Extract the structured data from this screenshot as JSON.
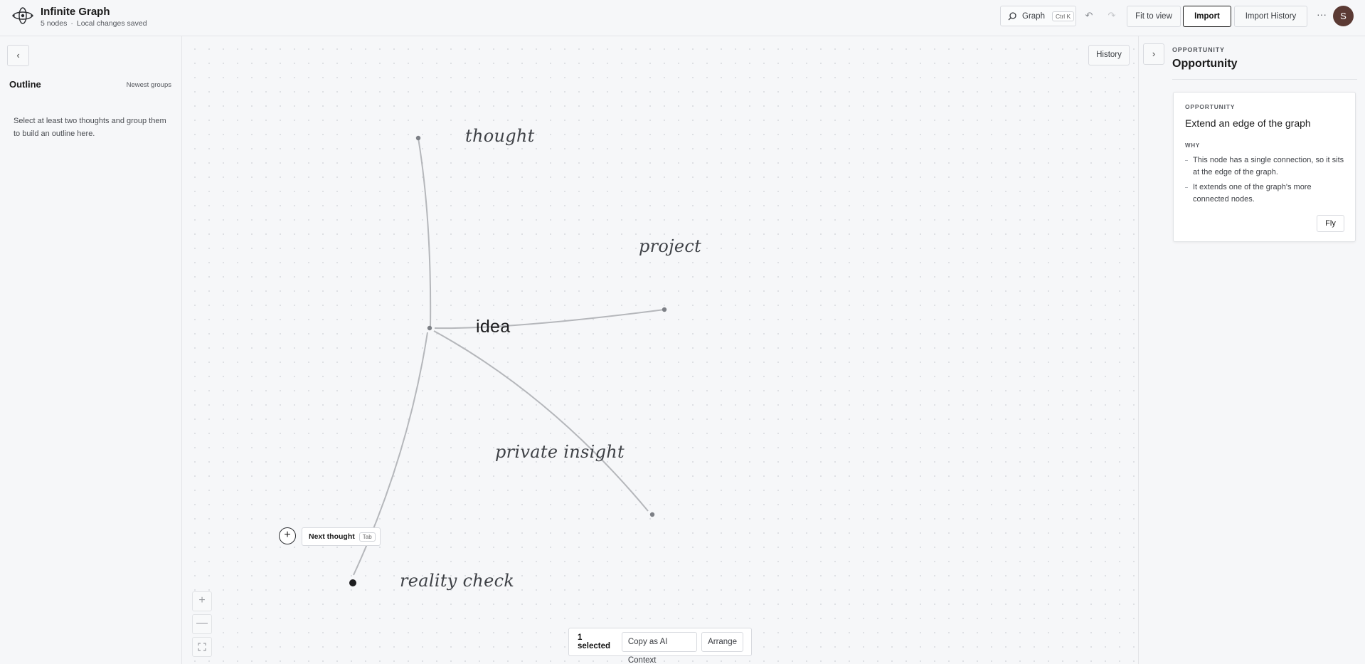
{
  "app": {
    "title": "Infinite Graph",
    "node_count": "5 nodes",
    "separator": "·",
    "save_status": "Local changes saved"
  },
  "toolbar": {
    "search_label": "Graph",
    "search_shortcut": "Ctrl K",
    "undo_icon": "undo-icon",
    "redo_icon": "redo-icon",
    "fit_label": "Fit to view",
    "import_label": "Import",
    "import_history_label": "Import History",
    "more_label": "···",
    "avatar_initial": "S"
  },
  "outline": {
    "collapse_label": "‹",
    "title": "Outline",
    "sort_label": "Newest groups",
    "empty_text": "Select at least two thoughts and group them to build an outline here."
  },
  "canvas": {
    "history_label": "History",
    "nodes": [
      {
        "id": "idea",
        "label": "idea",
        "center": true
      },
      {
        "id": "thought",
        "label": "thought"
      },
      {
        "id": "project",
        "label": "project"
      },
      {
        "id": "private-insight",
        "label": "private insight"
      },
      {
        "id": "reality-check",
        "label": "reality check",
        "selected": true
      }
    ],
    "edges": [
      [
        "idea",
        "thought"
      ],
      [
        "idea",
        "project"
      ],
      [
        "idea",
        "private-insight"
      ],
      [
        "idea",
        "reality-check"
      ]
    ],
    "add_label": "+",
    "next_thought_label": "Next thought",
    "next_thought_shortcut": "Tab",
    "zoom_in_label": "+",
    "zoom_out_label": "—",
    "fit_icon": "expand-icon"
  },
  "selection": {
    "count_label": "1 selected",
    "copy_label": "Copy as AI Context",
    "arrange_label": "Arrange"
  },
  "inspector": {
    "collapse_label": "›",
    "eyebrow": "OPPORTUNITY",
    "title": "Opportunity",
    "card": {
      "eyebrow": "OPPORTUNITY",
      "title": "Extend an edge of the graph",
      "why_label": "WHY",
      "reasons": [
        "This node has a single connection, so it sits at the edge of the graph.",
        "It extends one of the graph's more connected nodes."
      ],
      "fly_label": "Fly"
    }
  },
  "colors": {
    "background": "#f6f7f9",
    "edge": "#b5b7bb",
    "node_dot": "#7d8086",
    "selected_node": "#1d1d1f",
    "avatar": "#5b3a34"
  }
}
